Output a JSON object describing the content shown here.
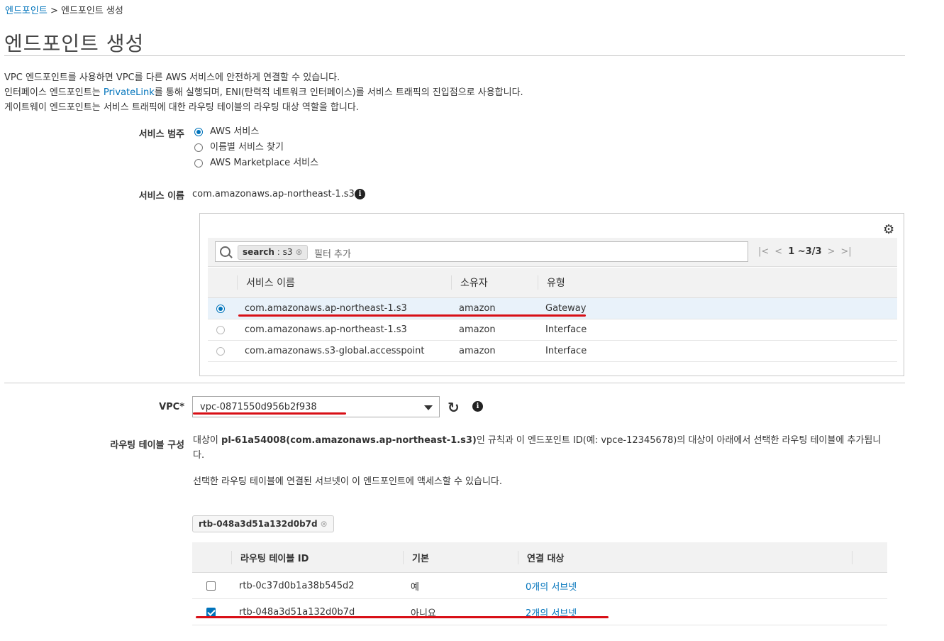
{
  "breadcrumb": {
    "parent": "엔드포인트",
    "separator": ">",
    "current": "엔드포인트 생성"
  },
  "page_title": "엔드포인트 생성",
  "description": {
    "line1": "VPC 엔드포인트를 사용하면 VPC를 다른 AWS 서비스에 안전하게 연결할 수 있습니다.",
    "line2_pre": "인터페이스 엔드포인트는 ",
    "line2_link": "PrivateLink",
    "line2_post": "를 통해 실행되며, ENI(탄력적 네트워크 인터페이스)를 서비스 트래픽의 진입점으로 사용합니다.",
    "line3": "게이트웨이 엔드포인트는 서비스 트래픽에 대한 라우팅 테이블의 라우팅 대상 역할을 합니다."
  },
  "service_category": {
    "label": "서비스 범주",
    "options": [
      "AWS 서비스",
      "이름별 서비스 찾기",
      "AWS Marketplace 서비스"
    ],
    "selected_index": 0
  },
  "service_name": {
    "label": "서비스 이름",
    "value": "com.amazonaws.ap-northeast-1.s3"
  },
  "service_panel": {
    "filter_token_key": "search",
    "filter_token_value": ": s3",
    "filter_placeholder": "필터 추가",
    "pager_text": "1 ~3/3",
    "columns": [
      "서비스 이름",
      "소유자",
      "유형"
    ],
    "rows": [
      {
        "name": "com.amazonaws.ap-northeast-1.s3",
        "owner": "amazon",
        "type": "Gateway",
        "selected": true
      },
      {
        "name": "com.amazonaws.ap-northeast-1.s3",
        "owner": "amazon",
        "type": "Interface",
        "selected": false
      },
      {
        "name": "com.amazonaws.s3-global.accesspoint",
        "owner": "amazon",
        "type": "Interface",
        "selected": false
      }
    ]
  },
  "vpc": {
    "label": "VPC*",
    "value": "vpc-0871550d956b2f938"
  },
  "route_table": {
    "label": "라우팅 테이블 구성",
    "text1_pre": "대상이 ",
    "text1_bold": "pl-61a54008(com.amazonaws.ap-northeast-1.s3)",
    "text1_post": "인 규칙과 이 엔드포인트 ID(예: vpce-12345678)의 대상이 아래에서 선택한 라우팅 테이블에 추가됩니다.",
    "text2": "선택한 라우팅 테이블에 연결된 서브넷이 이 엔드포인트에 액세스할 수 있습니다.",
    "selected_token": "rtb-048a3d51a132d0b7d",
    "columns": [
      "라우팅 테이블 ID",
      "기본",
      "연결 대상"
    ],
    "rows": [
      {
        "id": "rtb-0c37d0b1a38b545d2",
        "default": "예",
        "assoc": "0개의 서브넷",
        "checked": false
      },
      {
        "id": "rtb-048a3d51a132d0b7d",
        "default": "아니요",
        "assoc": "2개의 서브넷",
        "checked": true
      }
    ]
  },
  "colors": {
    "link": "#0073bb",
    "annotation_red": "#d80f16",
    "selected_row": "#e9f2fa"
  }
}
